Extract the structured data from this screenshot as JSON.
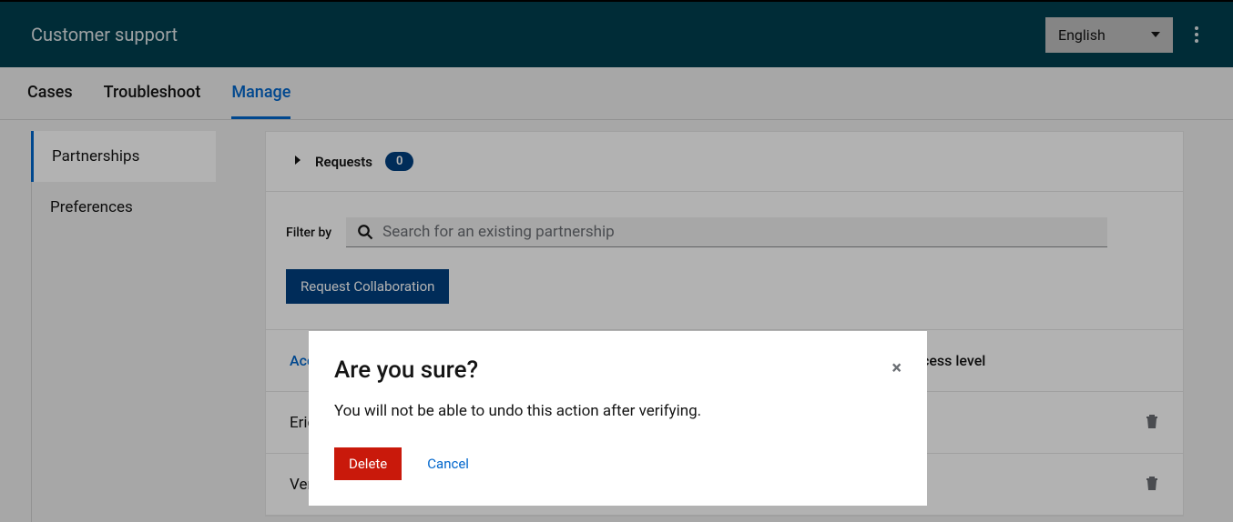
{
  "header": {
    "title": "Customer support",
    "language": "English"
  },
  "tabs": {
    "cases": "Cases",
    "troubleshoot": "Troubleshoot",
    "manage": "Manage"
  },
  "sidebar": {
    "partnerships": "Partnerships",
    "preferences": "Preferences"
  },
  "requests": {
    "label": "Requests",
    "count": "0"
  },
  "filter": {
    "label": "Filter by",
    "placeholder": "Search for an existing partnership"
  },
  "buttons": {
    "request_collab": "Request Collaboration"
  },
  "table": {
    "header_account": "Account",
    "header_access": "Access level",
    "rows": [
      {
        "account": "Eric"
      },
      {
        "account": "Ver"
      }
    ]
  },
  "modal": {
    "title": "Are you sure?",
    "body": "You will not be able to undo this action after verifying.",
    "delete": "Delete",
    "cancel": "Cancel",
    "close": "×"
  }
}
